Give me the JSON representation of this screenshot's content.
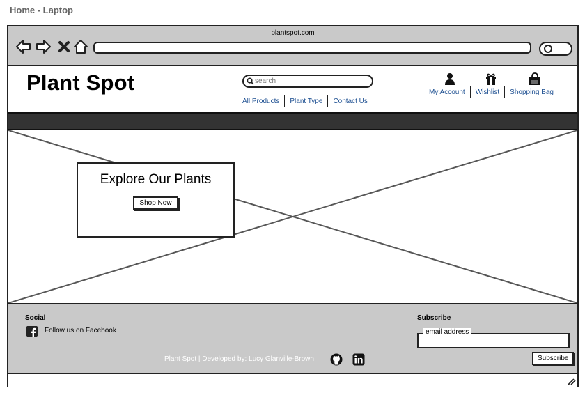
{
  "page_label": "Home - Laptop",
  "browser": {
    "url_title": "plantspot.com"
  },
  "header": {
    "logo": "Plant Spot",
    "search": {
      "placeholder": "search"
    },
    "main_links": [
      "All Products",
      "Plant Type",
      "Contact Us"
    ],
    "account_links": [
      "My Account",
      "Wishlist",
      "Shopping Bag"
    ]
  },
  "hero": {
    "heading": "Explore Our Plants",
    "button_label": "Shop Now"
  },
  "footer": {
    "social_heading": "Social",
    "facebook_label": "Follow us on Facebook",
    "credit": "Plant Spot | Developed by: Lucy Glanville-Brown",
    "subscribe_heading": "Subscribe",
    "email_legend": "email address",
    "subscribe_button": "Subscribe"
  },
  "icons": {
    "browser_nav": [
      "back-arrow-icon",
      "forward-arrow-icon",
      "close-icon",
      "home-icon"
    ],
    "header": [
      "user-icon",
      "gift-icon",
      "shopping-bag-icon"
    ],
    "footer": [
      "facebook-icon",
      "github-icon",
      "linkedin-icon"
    ]
  },
  "colors": {
    "frame_gray": "#c9c9c9",
    "nav_band": "#333333",
    "link_blue": "#1d4f91"
  }
}
